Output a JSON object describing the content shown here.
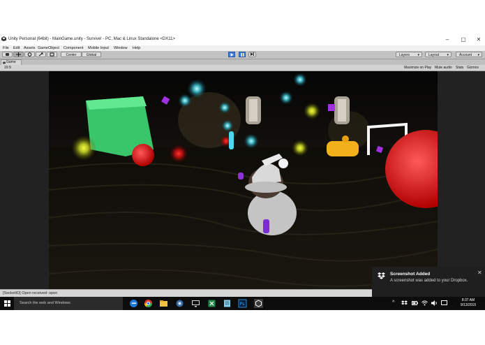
{
  "window": {
    "title": "Unity Personal (64bit) - MainGame.unity - Survive! - PC, Mac & Linux Standalone <DX11>",
    "controls": [
      "–",
      "▢",
      "✕"
    ]
  },
  "menu": [
    "File",
    "Edit",
    "Assets",
    "GameObject",
    "Component",
    "Mobile Input",
    "Window",
    "Help"
  ],
  "toolbar": {
    "center_label": "Center",
    "global_label": "Global",
    "layers_label": "Layers",
    "layout_label": "Layout",
    "account_label": "Account"
  },
  "game_panel": {
    "tab_label": "Game",
    "aspect": "16:9",
    "maximize_label": "Maximize on Play",
    "mute_label": "Mute audio",
    "stats_label": "Stats",
    "gizmos_label": "Gizmos"
  },
  "status": {
    "message": "[SocketIO] Open received: open"
  },
  "taskbar": {
    "search_placeholder": "Search the web and Windows",
    "time": "8:37 AM",
    "date": "9/13/2015",
    "pinned_icons": [
      "edge-icon",
      "chrome-icon",
      "file-explorer-icon",
      "network-icon",
      "monitor-icon",
      "excel-icon",
      "notepad-icon",
      "photoshop-icon",
      "unity-icon"
    ]
  },
  "notification": {
    "title": "Screenshot Added",
    "message": "A screenshot was added to your Dropbox."
  },
  "colors": {
    "play_blue": "#3d7bd8",
    "taskbar": "#0c0c0c",
    "toast_bg": "#1f1f1f"
  }
}
